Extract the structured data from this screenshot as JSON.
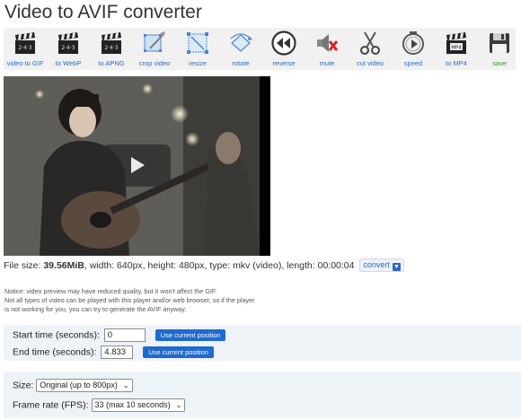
{
  "page": {
    "title": "Video to AVIF converter"
  },
  "toolbar": {
    "items": [
      {
        "label": "video to GIF",
        "icon": "clapperboard-gif-icon"
      },
      {
        "label": "to WebP",
        "icon": "clapperboard-webp-icon"
      },
      {
        "label": "to APNG",
        "icon": "clapperboard-apng-icon"
      },
      {
        "label": "crop video",
        "icon": "crop-icon"
      },
      {
        "label": "resize",
        "icon": "resize-icon"
      },
      {
        "label": "rotate",
        "icon": "rotate-icon"
      },
      {
        "label": "reverse",
        "icon": "reverse-icon"
      },
      {
        "label": "mute",
        "icon": "mute-icon"
      },
      {
        "label": "cut video",
        "icon": "scissors-icon"
      },
      {
        "label": "speed",
        "icon": "speed-icon"
      },
      {
        "label": "to MP4",
        "icon": "clapperboard-mp4-icon"
      },
      {
        "label": "save",
        "icon": "save-icon"
      }
    ],
    "colors": {
      "label": "#2a6cc8",
      "save_label": "#2e9a2e"
    }
  },
  "file_info": {
    "prefix": "File size: ",
    "size": "39.56MiB",
    "details": ", width: 640px, height: 480px, type: mkv (video), length: 00:00:04",
    "convert_label": "convert"
  },
  "notice": {
    "line1": "Notice: video preview may have reduced quality, but it won't affect the GIF.",
    "line2": "Not all types of video can be played with this player and/or web browser, so if the player",
    "line3": "is not working for you, you can try to generate the AVIF anyway."
  },
  "trim": {
    "start_label": "Start time (seconds):",
    "start_value": "0",
    "end_label": "End time (seconds):",
    "end_value": "4.833",
    "use_position_label": "Use current position"
  },
  "options": {
    "size_label": "Size:",
    "size_value": "Original (up to 800px)",
    "fps_label": "Frame rate (FPS):",
    "fps_value": "33 (max 10 seconds)"
  }
}
